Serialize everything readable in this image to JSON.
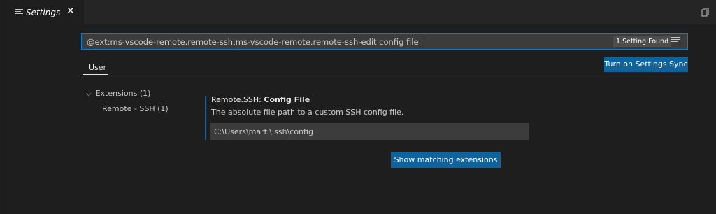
{
  "editor": {
    "tab": {
      "label": "Settings",
      "icon": "settings-list-icon",
      "close_icon": "close-icon"
    },
    "actions": {
      "open_json_icon": "open-settings-json-icon"
    }
  },
  "search": {
    "value": "@ext:ms-vscode-remote.remote-ssh,ms-vscode-remote.remote-ssh-edit config file",
    "results_badge": "1 Setting Found",
    "filter_icon": "filter-list-icon"
  },
  "scope": {
    "tabs": [
      {
        "label": "User"
      }
    ],
    "sync_button_label": "Turn on Settings Sync"
  },
  "toc": {
    "group_label": "Extensions (1)",
    "chevron_icon": "chevron-down-icon",
    "children": [
      {
        "label": "Remote - SSH (1)"
      }
    ]
  },
  "setting": {
    "category": "Remote.SSH: ",
    "name": "Config File",
    "description": "The absolute file path to a custom SSH config file.",
    "value": "C:\\Users\\marti\\.ssh\\config"
  },
  "matching_extensions_button_label": "Show matching extensions",
  "colors": {
    "accent": "#007fd4",
    "button": "#0e639c",
    "background": "#1e1e1e"
  }
}
